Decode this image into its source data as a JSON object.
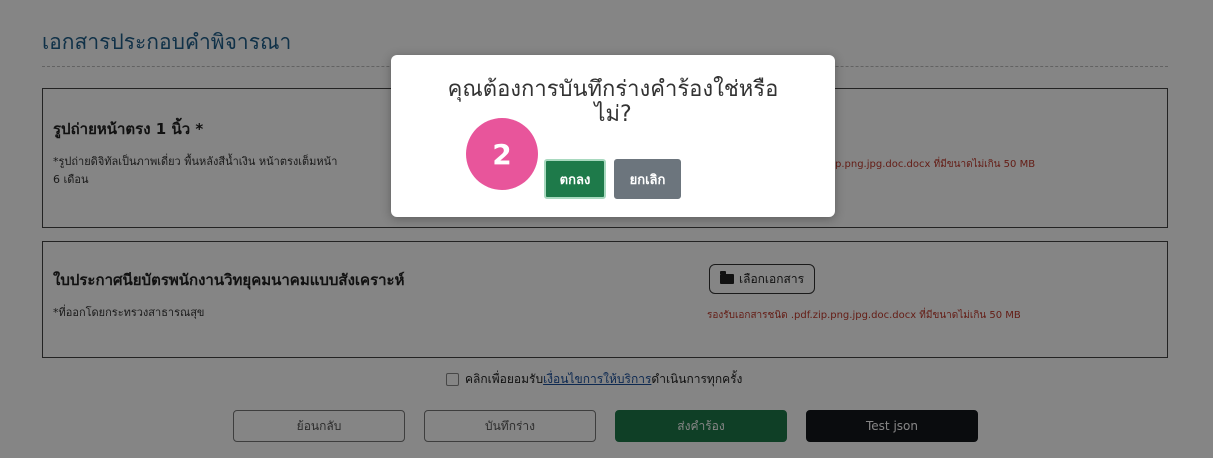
{
  "section": {
    "title": "เอกสารประกอบคำพิจารณา"
  },
  "documents": [
    {
      "name": "รูปถ่ายหน้าตรง 1 นิ้ว *",
      "desc_line1": "*รูปถ่ายดิจิทัลเป็นภาพเดี่ยว พื้นหลังสีน้ำเงิน หน้าตรงเต็มหน้า",
      "desc_line2": "6 เดือน",
      "file_note": "p.png.jpg.doc.docx ที่มีขนาดไม่เกิน 50 MB"
    },
    {
      "name": "ใบประกาศนียบัตรพนักงานวิทยุคมนาคมแบบสังเคราะห์",
      "desc_line1": "*ที่ออกโดยกระทรวงสาธารณสุข",
      "pick_button": "เลือกเอกสาร",
      "file_note": "รองรับเอกสารชนิด .pdf.zip.png.jpg.doc.docx ที่มีขนาดไม่เกิน 50 MB"
    }
  ],
  "agreement": {
    "prefix": "คลิกเพื่อยอมรับ",
    "link": "เงื่อนไขการให้บริการ",
    "suffix": "ดำเนินการทุกครั้ง"
  },
  "footer": {
    "back": "ย้อนกลับ",
    "save_draft": "บันทึกร่าง",
    "submit": "ส่งคำร้อง",
    "test_json": "Test json"
  },
  "modal": {
    "title_line1": "คุณต้องการบันทึกร่างคำร้องใช่หรือ",
    "title_line2": "ไม่?",
    "step_badge": "2",
    "ok": "ตกลง",
    "cancel": "ยกเลิก"
  },
  "colors": {
    "primary_green": "#1e7a4a",
    "title_blue": "#1f5f8b",
    "note_red": "#c0392b",
    "badge_pink": "#e8559b"
  }
}
